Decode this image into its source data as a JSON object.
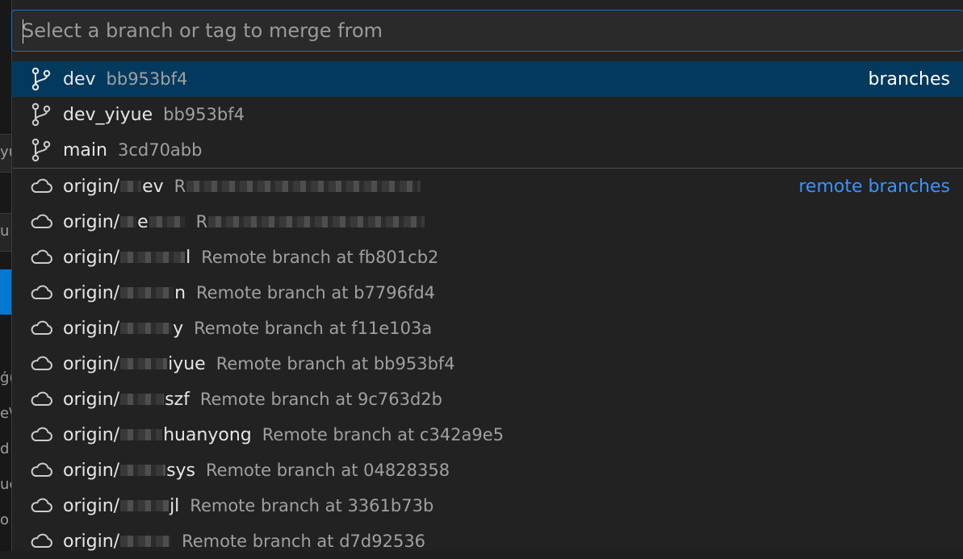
{
  "search": {
    "placeholder": "Select a branch or tag to merge from"
  },
  "background_fragments": [
    "yu",
    "u",
    "ģ(",
    "e\\",
    "d",
    "uc",
    "o"
  ],
  "branches": {
    "group_label": "branches",
    "items": [
      {
        "name": "dev",
        "hash": "bb953bf4",
        "icon": "git-branch-icon"
      },
      {
        "name": "dev_yiyue",
        "hash": "bb953bf4",
        "icon": "git-branch-icon"
      },
      {
        "name": "main",
        "hash": "3cd70abb",
        "icon": "git-branch-icon"
      }
    ]
  },
  "remote_branches": {
    "group_label": "remote branches",
    "items": [
      {
        "prefix": "origin/",
        "visible": "ev",
        "desc": "R",
        "icon": "cloud-icon"
      },
      {
        "prefix": "origin/",
        "visible": "e",
        "desc": "R",
        "icon": "cloud-icon"
      },
      {
        "prefix": "origin/",
        "visible": "l",
        "desc": "Remote branch at fb801cb2",
        "icon": "cloud-icon"
      },
      {
        "prefix": "origin/",
        "visible": "n",
        "desc": "Remote branch at b7796fd4",
        "icon": "cloud-icon"
      },
      {
        "prefix": "origin/",
        "visible": "y",
        "desc": "Remote branch at f11e103a",
        "icon": "cloud-icon"
      },
      {
        "prefix": "origin/",
        "visible": "iyue",
        "desc": "Remote branch at bb953bf4",
        "icon": "cloud-icon"
      },
      {
        "prefix": "origin/",
        "visible": "szf",
        "desc": "Remote branch at 9c763d2b",
        "icon": "cloud-icon"
      },
      {
        "prefix": "origin/",
        "visible": "huanyong",
        "desc": "Remote branch at c342a9e5",
        "icon": "cloud-icon"
      },
      {
        "prefix": "origin/",
        "visible": "sys",
        "desc": "Remote branch at 04828358",
        "icon": "cloud-icon"
      },
      {
        "prefix": "origin/",
        "visible": "jl",
        "desc": "Remote branch at 3361b73b",
        "icon": "cloud-icon"
      },
      {
        "prefix": "origin/",
        "visible": "",
        "desc": "Remote branch at d7d92536",
        "icon": "cloud-icon"
      }
    ]
  },
  "colors": {
    "accent": "#0078d4",
    "selected": "#04395e",
    "link": "#3794ff"
  }
}
